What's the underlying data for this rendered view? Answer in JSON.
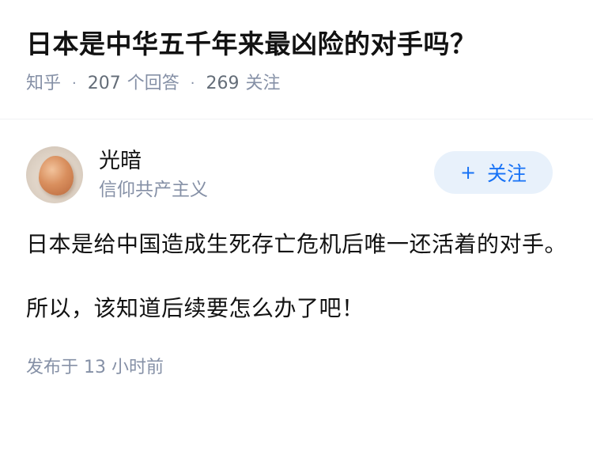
{
  "question": {
    "title": "日本是中华五千年来最凶险的对手吗？",
    "source": "知乎",
    "answer_count": "207",
    "answer_label": "个回答",
    "follow_count": "269",
    "follow_label": "关注",
    "separator": "·"
  },
  "answer": {
    "author": {
      "name": "光暗",
      "bio": "信仰共产主义",
      "avatar_icon": "egg-avatar"
    },
    "follow_button": {
      "plus": "+",
      "label": "关注"
    },
    "paragraphs": [
      "日本是给中国造成生死存亡危机后唯一还活着的对手。",
      "所以，该知道后续要怎么办了吧！"
    ],
    "publish_time": "发布于 13 小时前"
  },
  "colors": {
    "title": "#121212",
    "meta": "#8590a6",
    "accent": "#1772f6",
    "button_bg": "#e8f1fb"
  }
}
